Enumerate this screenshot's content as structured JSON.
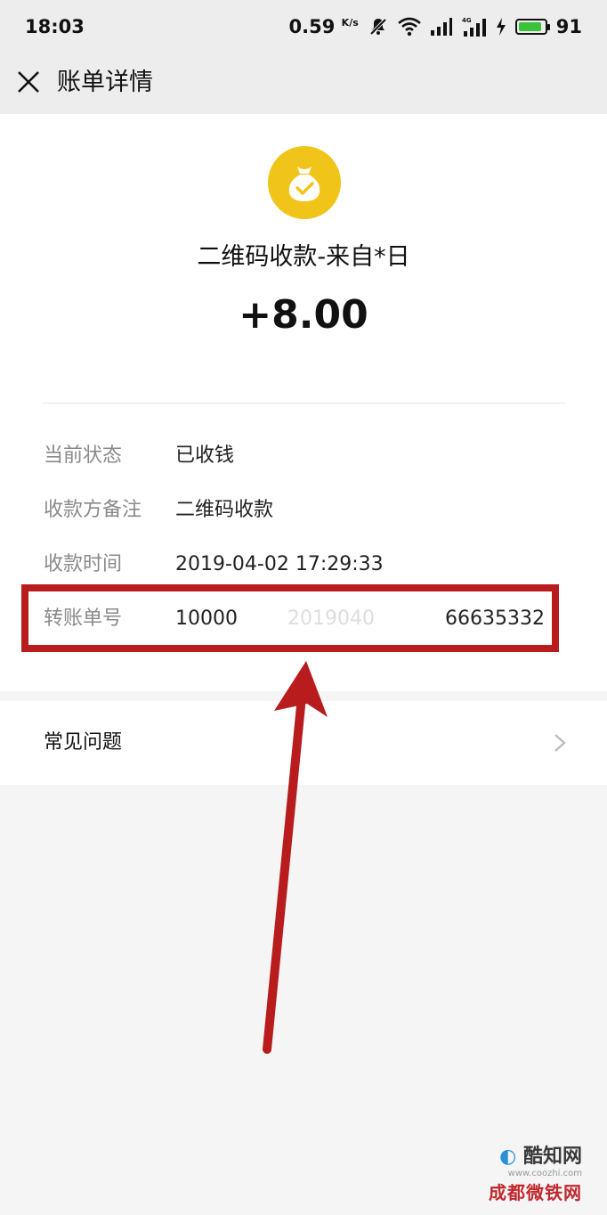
{
  "status_bar": {
    "time": "18:03",
    "network_speed": "0.59",
    "network_unit": "K/s",
    "battery_level": "91"
  },
  "navbar": {
    "title": "账单详情"
  },
  "transaction": {
    "title": "二维码收款-来自*日",
    "amount": "+8.00",
    "icon_color": "#f0c419",
    "details": [
      {
        "label": "当前状态",
        "value": "已收钱"
      },
      {
        "label": "收款方备注",
        "value": "二维码收款"
      },
      {
        "label": "收款时间",
        "value": "2019-04-02 17:29:33"
      }
    ],
    "transfer_no": {
      "label": "转账单号",
      "part1": "10000",
      "part2": "2019040",
      "part3": "66635332"
    }
  },
  "faq": {
    "label": "常见问题"
  },
  "annotation": {
    "color": "#b81c1c"
  },
  "watermark": {
    "line1": "酷知网",
    "url": "www.coozhi.com",
    "line2": "成都微铁网"
  }
}
